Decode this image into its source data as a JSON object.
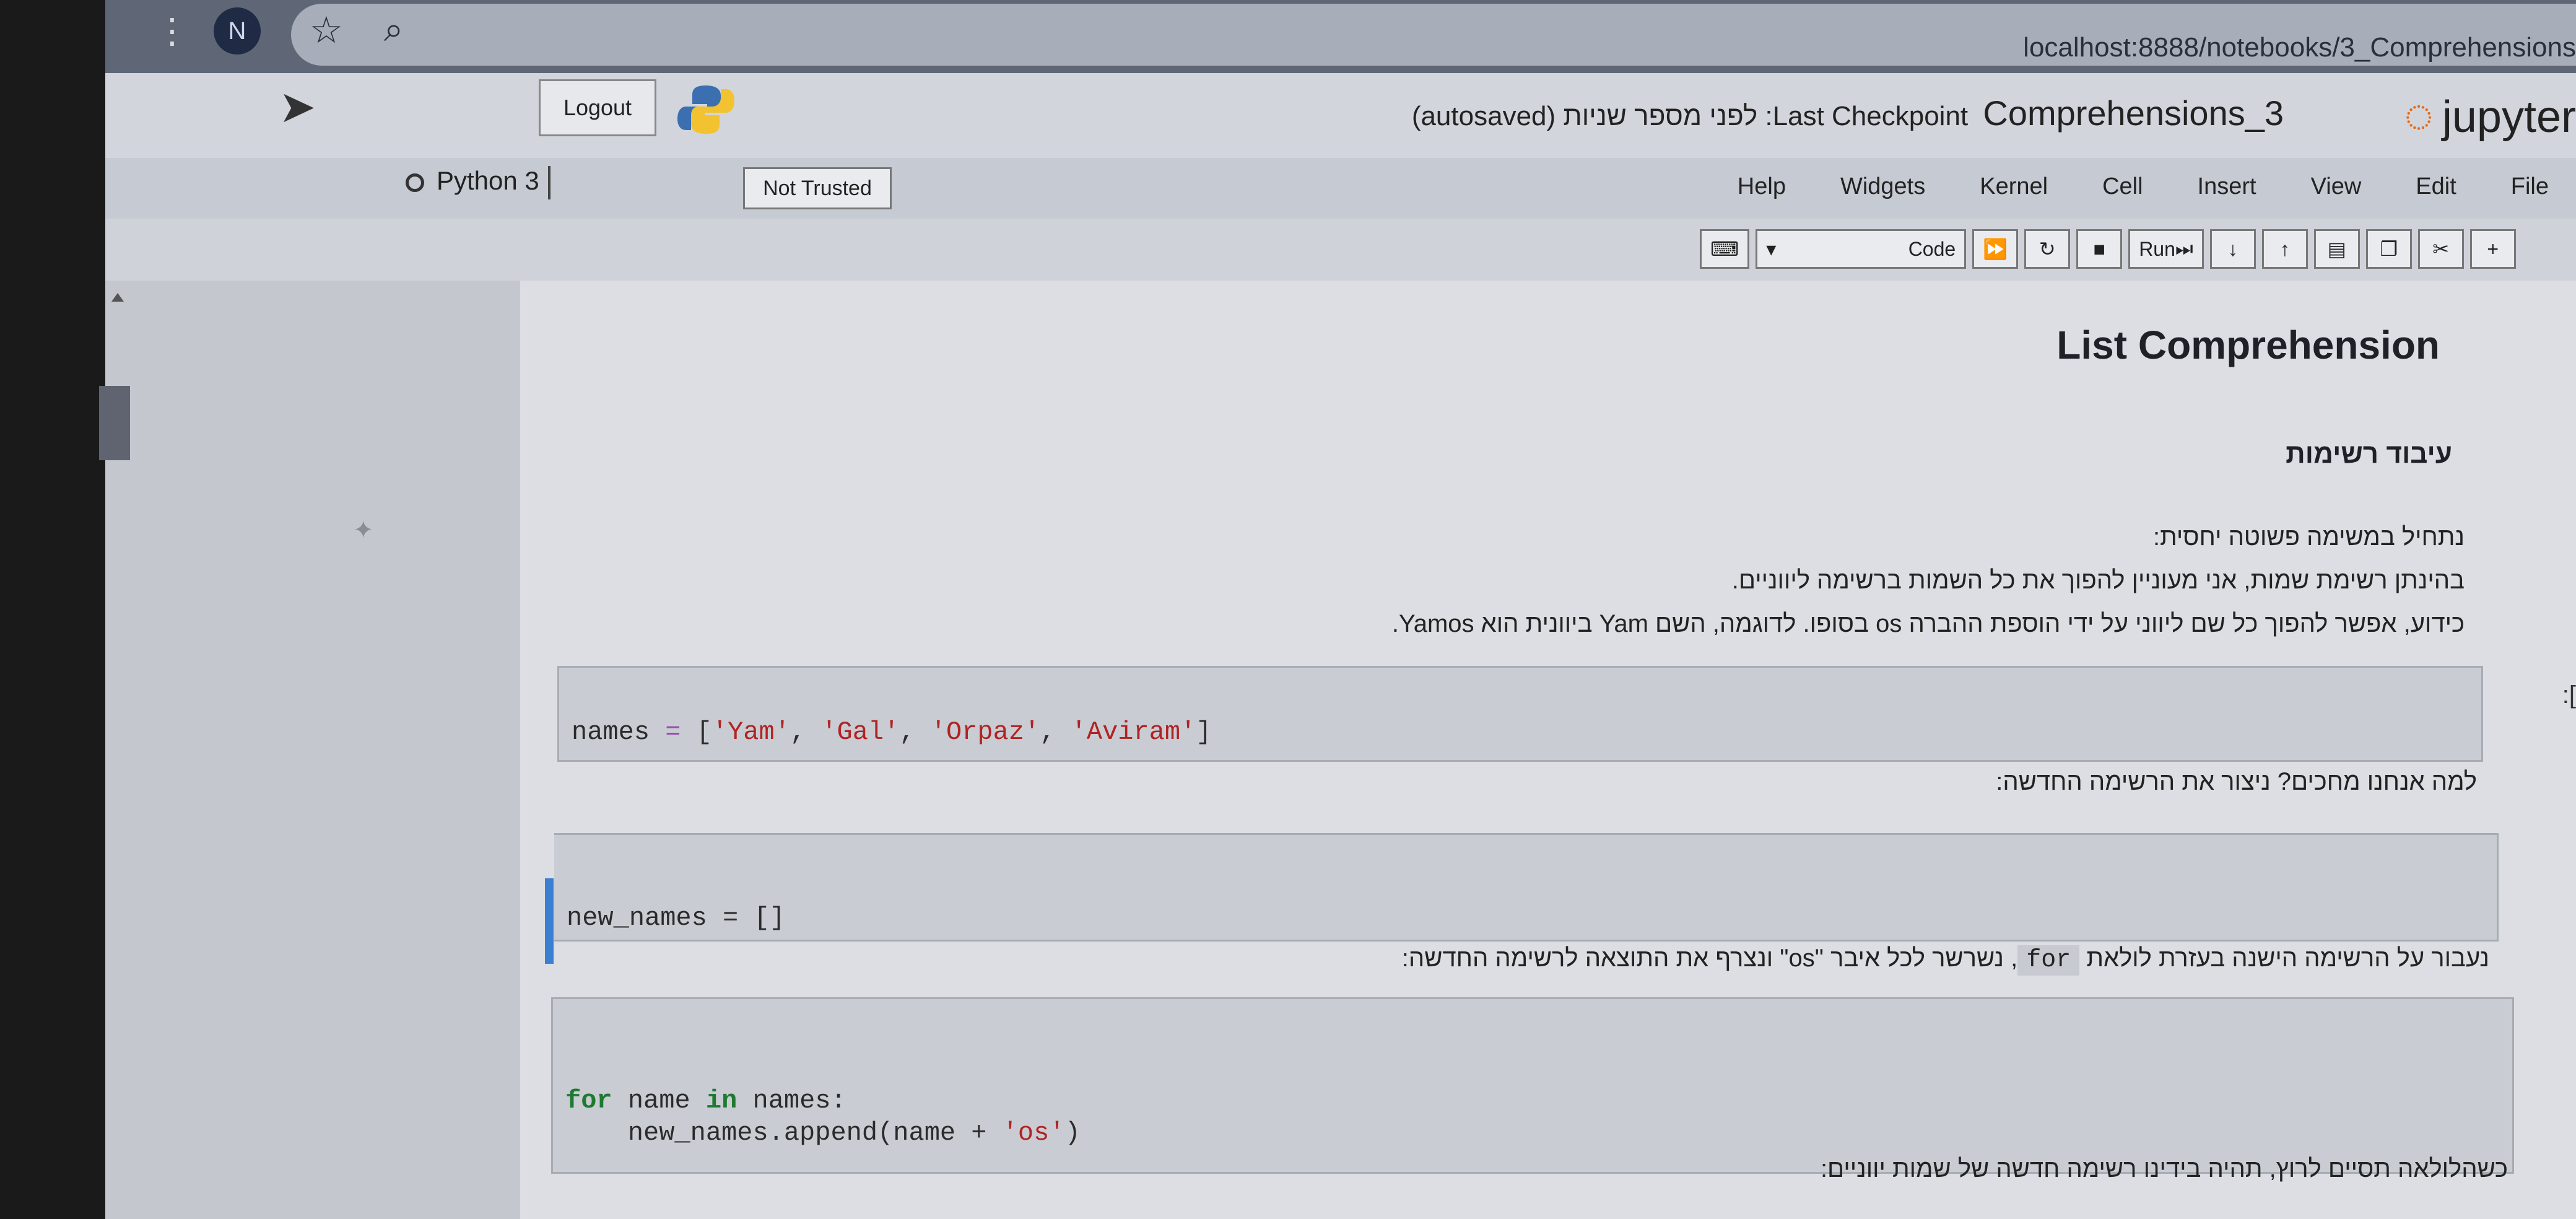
{
  "browser": {
    "avatar_letter": "N",
    "url": "localhost:8888/notebooks/3_Comprehensions"
  },
  "header": {
    "logout_label": "Logout",
    "autosaved": "(autosaved)",
    "checkpoint_text": "לפני מספר שניות :Last Checkpoint",
    "notebook_name": "Comprehensions_3",
    "logo_text": "jupyter"
  },
  "menubar": {
    "kernel_name": "Python 3",
    "trusted_label": "Not Trusted",
    "items": [
      "File",
      "Edit",
      "View",
      "Insert",
      "Cell",
      "Kernel",
      "Widgets",
      "Help"
    ]
  },
  "toolbar": {
    "cell_type": "Code",
    "run_label": "Run"
  },
  "content": {
    "title": "List Comprehension",
    "subtitle": "עיבוד רשימות",
    "p1": "נתחיל במשימה פשוטה יחסית:",
    "p2": "בהינתן רשימת שמות, אני מעוניין להפוך את כל השמות ברשימה ליווניים.",
    "p3": "כידוע, אפשר להפוך כל שם ליווני על ידי הוספת ההברה os בסופו. לדוגמה, השם Yam ביוונית הוא Yamos.",
    "p4": "למה אנחנו מחכים? ניצור את הרשימה החדשה:",
    "p5_after": ", נשרשר לכל איבר \"os\" ונצרף את התוצאה לרשימה החדשה:",
    "p5_code": "for",
    "p5_before": "נעבור על הרשימה הישנה בעזרת לולאת",
    "p6": "כשהלולאה תסיים לרוץ, תהיה בידינו רשימה חדשה של שמות יווניים:"
  },
  "cells": {
    "c1": {
      "var": "names",
      "items": [
        "'Yam'",
        "'Gal'",
        "'Orpaz'",
        "'Aviram'"
      ]
    },
    "c2": {
      "code": "new_names = []"
    },
    "c3": {
      "line1_kw": "for",
      "line1_rest": " name ",
      "line1_in": "in",
      "line1_end": " names:",
      "line2": "    new_names.append(name + ",
      "line2_str": "'os'",
      "line2_end": ")"
    }
  }
}
